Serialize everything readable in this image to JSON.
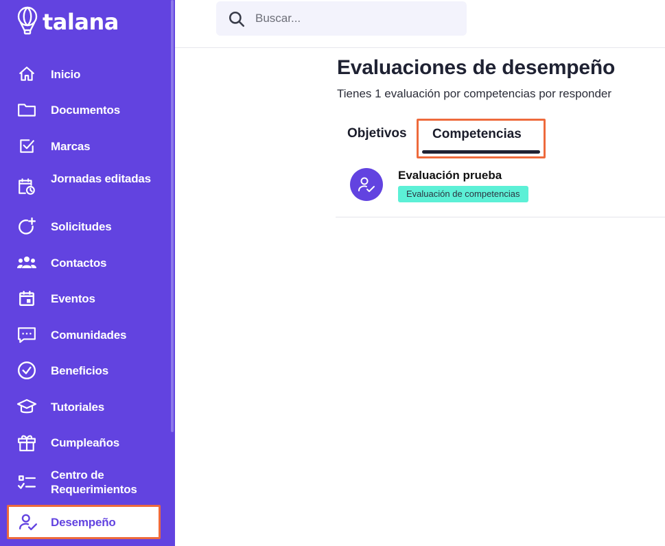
{
  "brand": {
    "name": "talana",
    "logo_icon": "balloon-icon"
  },
  "colors": {
    "sidebar": "#6243e0",
    "highlight": "#ee6a3c",
    "badge": "#5cf0d6"
  },
  "sidebar": {
    "items": [
      {
        "label": "Inicio",
        "icon": "home-icon"
      },
      {
        "label": "Documentos",
        "icon": "folder-icon"
      },
      {
        "label": "Marcas",
        "icon": "checkbox-icon"
      },
      {
        "label": "Jornadas editadas",
        "icon": "calendar-clock-icon"
      },
      {
        "label": "Solicitudes",
        "icon": "refresh-plus-icon"
      },
      {
        "label": "Contactos",
        "icon": "people-icon"
      },
      {
        "label": "Eventos",
        "icon": "calendar-event-icon"
      },
      {
        "label": "Comunidades",
        "icon": "chat-icon"
      },
      {
        "label": "Beneficios",
        "icon": "check-circle-icon"
      },
      {
        "label": "Tutoriales",
        "icon": "graduation-cap-icon"
      },
      {
        "label": "Cumpleaños",
        "icon": "gift-icon"
      },
      {
        "label": "Centro de Requerimientos",
        "icon": "checklist-icon"
      },
      {
        "label": "Desempeño",
        "icon": "user-check-icon",
        "active": true
      }
    ]
  },
  "search": {
    "placeholder": "Buscar..."
  },
  "main": {
    "title": "Evaluaciones de desempeño",
    "subtitle": "Tienes 1 evaluación por competencias por responder",
    "tabs": [
      {
        "label": "Objetivos",
        "active": false
      },
      {
        "label": "Competencias",
        "active": true
      }
    ],
    "evaluations": [
      {
        "title": "Evaluación prueba",
        "badge": "Evaluación de competencias",
        "icon": "user-check-icon"
      }
    ]
  }
}
